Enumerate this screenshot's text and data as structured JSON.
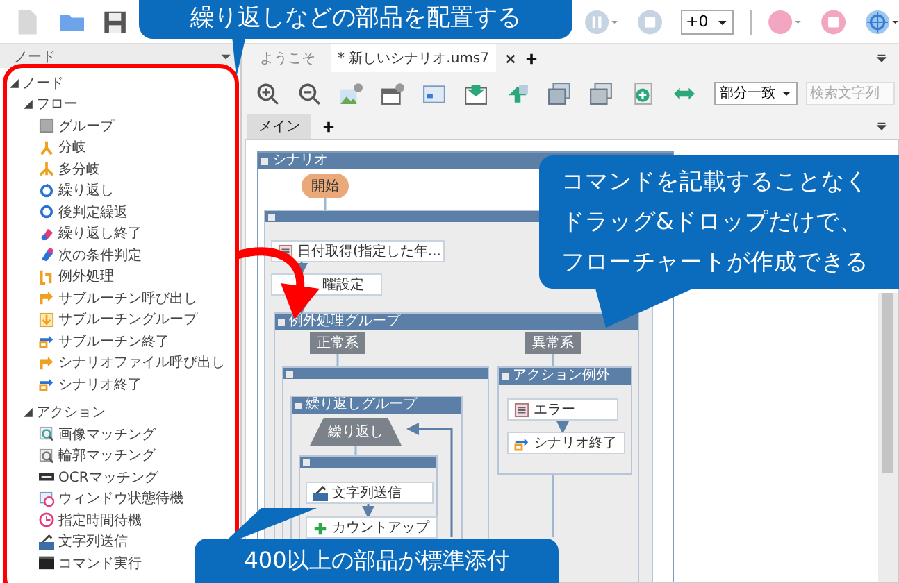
{
  "toolbar": {
    "speed": "+0"
  },
  "node_panel": {
    "title": "ノード",
    "tree": [
      {
        "label": "ノード",
        "expanded": true,
        "children": [
          {
            "label": "フロー",
            "expanded": true,
            "children": [
              {
                "label": "グループ"
              },
              {
                "label": "分岐"
              },
              {
                "label": "多分岐"
              },
              {
                "label": "繰り返し"
              },
              {
                "label": "後判定繰返"
              },
              {
                "label": "繰り返し終了"
              },
              {
                "label": "次の条件判定"
              },
              {
                "label": "例外処理"
              },
              {
                "label": "サブルーチン呼び出し"
              },
              {
                "label": "サブルーチングループ"
              },
              {
                "label": "サブルーチン終了"
              },
              {
                "label": "シナリオファイル呼び出し"
              },
              {
                "label": "シナリオ終了"
              }
            ]
          },
          {
            "label": "アクション",
            "expanded": true,
            "children": [
              {
                "label": "画像マッチング"
              },
              {
                "label": "輪郭マッチング"
              },
              {
                "label": "OCRマッチング"
              },
              {
                "label": "ウィンドウ状態待機"
              },
              {
                "label": "指定時間待機"
              },
              {
                "label": "文字列送信"
              },
              {
                "label": "コマンド実行"
              }
            ]
          }
        ]
      }
    ]
  },
  "doc_tabs": [
    {
      "label": "ようこそ",
      "selected": false
    },
    {
      "label": "* 新しいシナリオ.ums7",
      "selected": true
    }
  ],
  "search": {
    "mode": "部分一致",
    "placeholder": "検索文字列"
  },
  "sheet_tabs": [
    {
      "label": "メイン",
      "selected": true
    }
  ],
  "flowchart": {
    "frames": [
      {
        "kind": "frame",
        "title": "シナリオ"
      },
      {
        "kind": "frame"
      },
      {
        "kind": "frame",
        "title": "例外処理グループ"
      },
      {
        "kind": "frame"
      },
      {
        "kind": "frame",
        "title": "繰り返しグループ"
      },
      {
        "kind": "frame"
      },
      {
        "kind": "frame",
        "title": "アクション例外"
      }
    ],
    "nodes": [
      {
        "kind": "start",
        "label": "開始"
      },
      {
        "kind": "step",
        "label": "日付取得(指定した年..."
      },
      {
        "kind": "step",
        "label": "曜設定"
      },
      {
        "kind": "branch",
        "label": "正常系"
      },
      {
        "kind": "branch",
        "label": "異常系"
      },
      {
        "kind": "loop",
        "label": "繰り返し"
      },
      {
        "kind": "step",
        "label": "文字列送信"
      },
      {
        "kind": "step",
        "label": "カウントアップ"
      },
      {
        "kind": "step",
        "label": "エラー"
      },
      {
        "kind": "step",
        "label": "シナリオ終了"
      }
    ]
  },
  "callouts": [
    {
      "lines": [
        "繰り返しなどの部品を配置する"
      ]
    },
    {
      "lines": [
        "コマンドを記載することなく",
        "ドラッグ&ドロップだけで、",
        "フローチャートが作成できる"
      ]
    },
    {
      "lines": [
        "400以上の部品が標準添付"
      ]
    }
  ]
}
